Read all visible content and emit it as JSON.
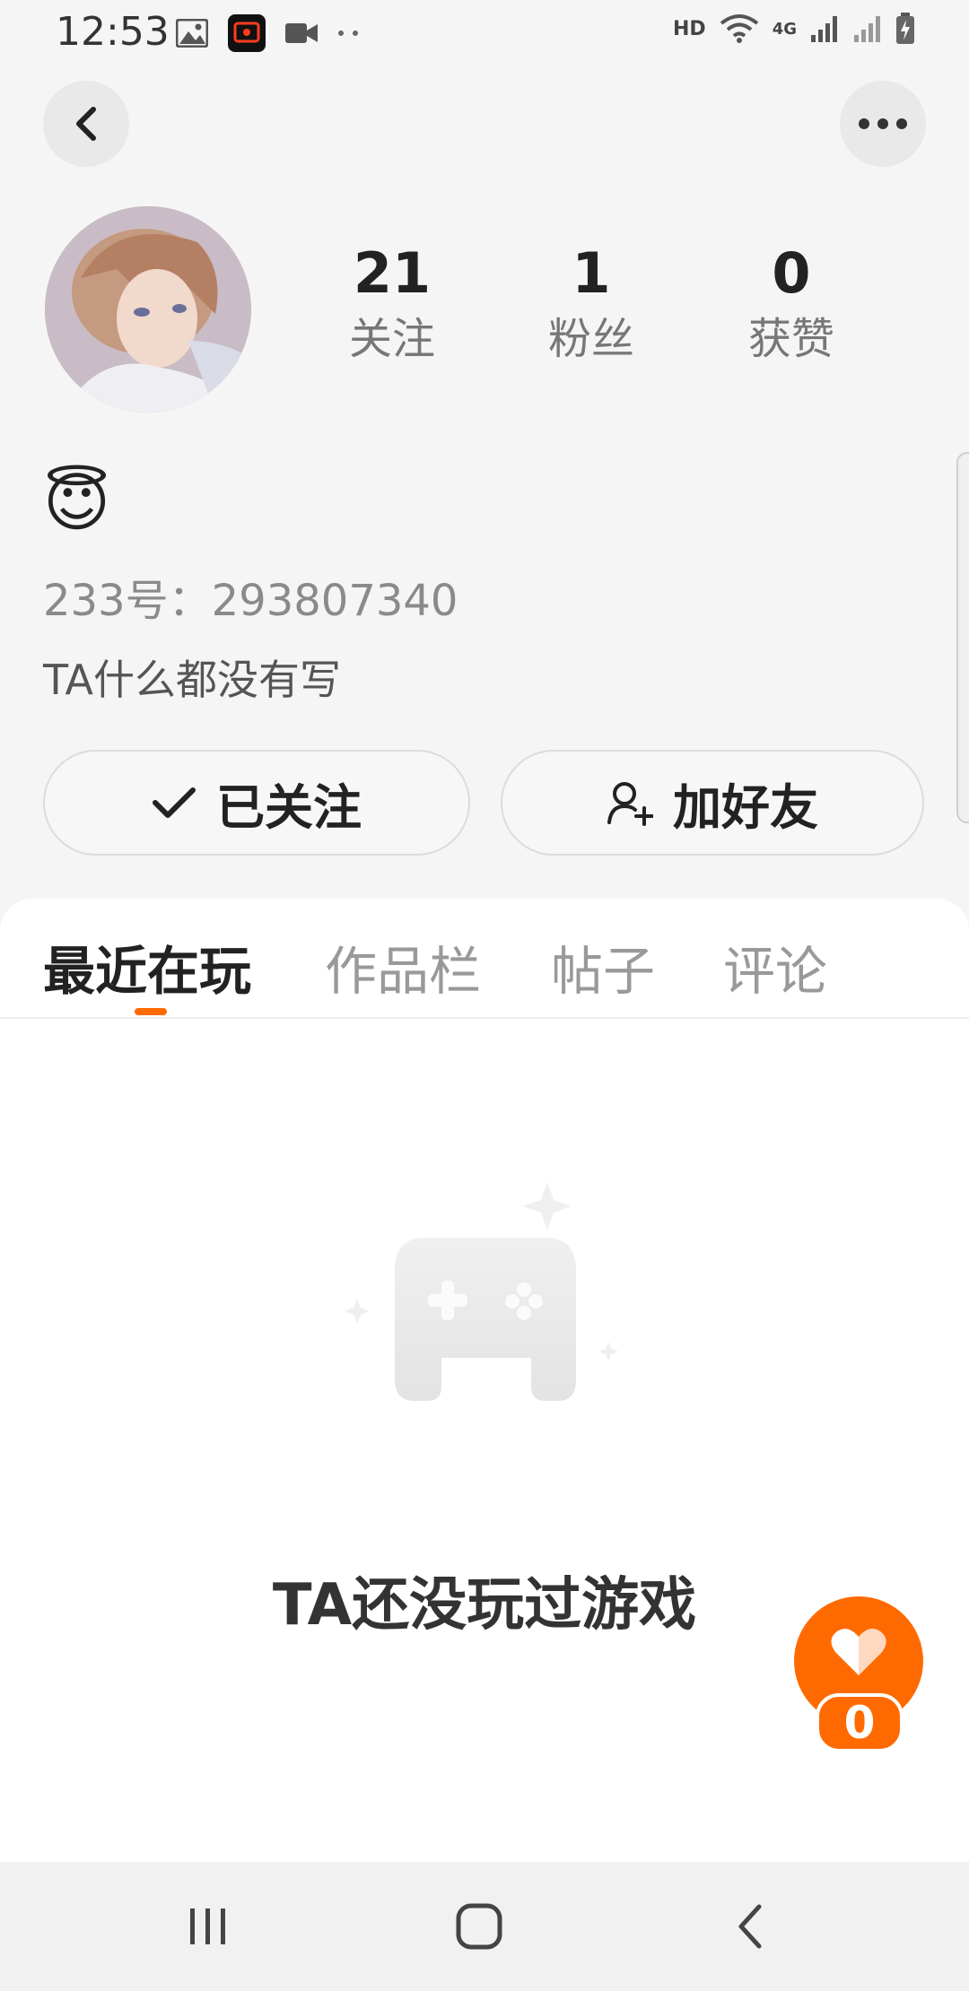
{
  "status_bar": {
    "time": "12:53",
    "hd": "HD",
    "network": "4G"
  },
  "profile": {
    "stats": [
      {
        "value": "21",
        "label": "关注"
      },
      {
        "value": "1",
        "label": "粉丝"
      },
      {
        "value": "0",
        "label": "获赞"
      }
    ],
    "emoji": "😇",
    "user_id": "233号：293807340",
    "bio": "TA什么都没有写",
    "follow_button": "已关注",
    "add_friend_button": "加好友"
  },
  "tabs": [
    {
      "label": "最近在玩"
    },
    {
      "label": "作品栏"
    },
    {
      "label": "帖子"
    },
    {
      "label": "评论"
    }
  ],
  "empty_state": {
    "text": "TA还没玩过游戏"
  },
  "like_fab": {
    "count": "0"
  },
  "colors": {
    "accent": "#ff6a00",
    "background": "#f5f5f5",
    "panel": "#ffffff"
  },
  "icons": {
    "back": "back-arrow-icon",
    "more": "more-dots-icon",
    "check": "check-icon",
    "add_friend": "person-add-icon",
    "heart": "heart-icon"
  }
}
